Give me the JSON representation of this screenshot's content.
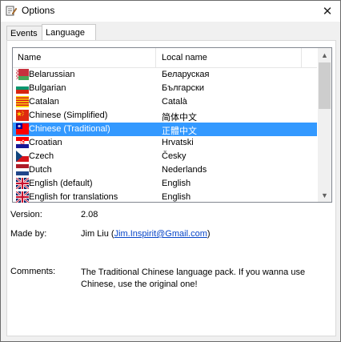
{
  "window": {
    "title": "Options",
    "close_glyph": "✕"
  },
  "tabs": [
    {
      "label": "Events",
      "active": false
    },
    {
      "label": "Language",
      "active": true
    }
  ],
  "list": {
    "headers": {
      "name": "Name",
      "local": "Local name"
    },
    "rows": [
      {
        "name": "Belarussian",
        "local": "Беларуская",
        "flag": "belarus-flag-icon",
        "selected": false
      },
      {
        "name": "Bulgarian",
        "local": "Български",
        "flag": "bulgaria-flag-icon",
        "selected": false
      },
      {
        "name": "Catalan",
        "local": "Català",
        "flag": "catalonia-flag-icon",
        "selected": false
      },
      {
        "name": "Chinese (Simplified)",
        "local": "简体中文",
        "flag": "china-flag-icon",
        "selected": false
      },
      {
        "name": "Chinese (Traditional)",
        "local": "正體中文",
        "flag": "taiwan-flag-icon",
        "selected": true
      },
      {
        "name": "Croatian",
        "local": "Hrvatski",
        "flag": "croatia-flag-icon",
        "selected": false
      },
      {
        "name": "Czech",
        "local": "Česky",
        "flag": "czech-flag-icon",
        "selected": false
      },
      {
        "name": "Dutch",
        "local": "Nederlands",
        "flag": "netherlands-flag-icon",
        "selected": false
      },
      {
        "name": "English (default)",
        "local": "English",
        "flag": "uk-flag-icon",
        "selected": false
      },
      {
        "name": "English for translations",
        "local": "English",
        "flag": "uk-flag-icon",
        "selected": false
      }
    ]
  },
  "info": {
    "version_label": "Version:",
    "version_value": "2.08",
    "madeby_label": "Made by:",
    "author": "Jim Liu",
    "open_paren": "(",
    "email": "Jim.Inspirit@Gmail.com",
    "close_paren": ")",
    "comments_label": "Comments:",
    "comments_value": "The Traditional Chinese language pack. If you wanna use Chinese, use the original one!"
  },
  "colors": {
    "selection": "#3399ff",
    "link": "#0645c8"
  }
}
